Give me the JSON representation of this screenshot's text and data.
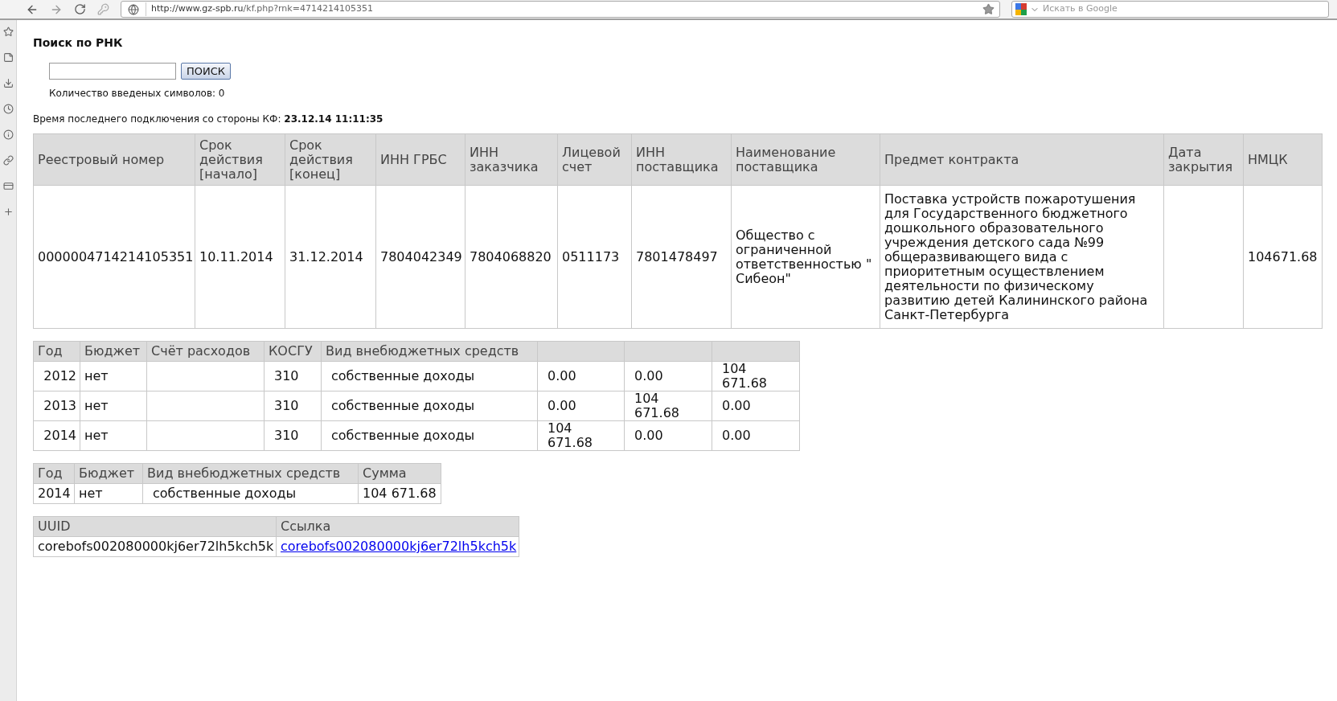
{
  "browser": {
    "url_host": "http://www.gz-spb.ru",
    "url_path": "/kf.php?rnk=4714214105351",
    "search_placeholder": "Искать в Google"
  },
  "page": {
    "title": "Поиск по РНК",
    "search_button": "ПОИСК",
    "char_count": "Количество введеных символов: 0",
    "last_connection_label": "Время последнего подключения со стороны КФ:",
    "last_connection_value": "23.12.14 11:11:35"
  },
  "tables": [
    {
      "columns": [
        "Реестровый номер",
        "Срок действия [начало]",
        "Срок действия [конец]",
        "ИНН ГРБС",
        "ИНН заказчика",
        "Лицевой счет",
        "ИНН поставщика",
        "Наименование поставщика",
        "Предмет контракта",
        "Дата закрытия",
        "НМЦК"
      ],
      "rows": [
        [
          "0000004714214105351",
          "10.11.2014",
          "31.12.2014",
          "7804042349",
          "7804068820",
          "0511173",
          "7801478497",
          "Общество с ограниченной ответственностью \" Сибеон\"",
          "Поставка устройств пожаротушения для Государственного бюджетного дошкольного образовательного учреждения детского сада №99 общеразвивающего вида с приоритетным осуществлением деятельности по физическому развитию детей Калининского района Санкт-Петербурга",
          null,
          "104671.68"
        ]
      ]
    },
    {
      "columns": [
        "Год",
        "Бюджет",
        "Счёт расходов",
        "КОСГУ",
        "Вид внебюджетных средств",
        null,
        null,
        null
      ],
      "rows": [
        [
          "2012",
          "нет",
          null,
          "310",
          "собственные доходы",
          "0.00",
          "0.00",
          "104 671.68"
        ],
        [
          "2013",
          "нет",
          null,
          "310",
          "собственные доходы",
          "0.00",
          "104 671.68",
          "0.00"
        ],
        [
          "2014",
          "нет",
          null,
          "310",
          "собственные доходы",
          "104 671.68",
          "0.00",
          "0.00"
        ]
      ]
    },
    {
      "columns": [
        "Год",
        "Бюджет",
        "Вид внебюджетных средств",
        "Сумма"
      ],
      "rows": [
        [
          "2014",
          "нет",
          "собственные доходы",
          "104 671.68"
        ]
      ]
    },
    {
      "columns": [
        "UUID",
        "Ссылка"
      ],
      "rows": [
        [
          "corebofs002080000kj6er72lh5kch5k",
          {
            "kind": "link",
            "text": "corebofs002080000kj6er72lh5kch5k"
          }
        ]
      ]
    }
  ]
}
